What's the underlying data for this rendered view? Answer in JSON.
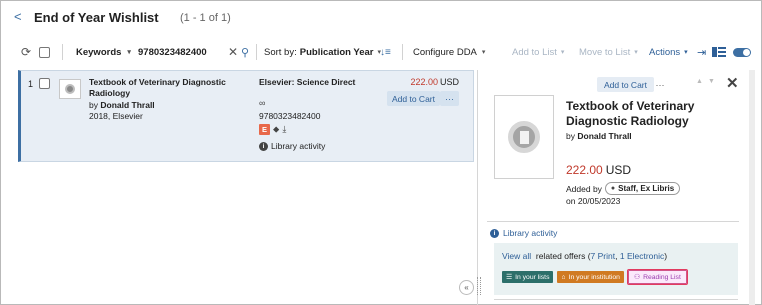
{
  "header": {
    "back_glyph": "<",
    "title": "End of Year Wishlist",
    "count": "(1 - 1 of 1)"
  },
  "toolbar": {
    "refresh_glyph": "⟳",
    "search_field": "Keywords",
    "search_value": "9780323482400",
    "clear_glyph": "✕",
    "search_glyph": "⚲",
    "sort_label": "Sort by:",
    "sort_value": "Publication Year",
    "sort_dir_glyph": "↓≡",
    "configure_dda": "Configure DDA",
    "add_to_list": "Add to List",
    "move_to_list": "Move to List",
    "actions": "Actions",
    "export_glyph": "⇥",
    "caret": "▾",
    "toggle_on": true
  },
  "result": {
    "row_number": "1",
    "title": "Textbook of Veterinary Diagnostic Radiology",
    "by": "by",
    "author": "Donald Thrall",
    "year_publisher": "2018, Elsevier",
    "vendor": "Elsevier: Science Direct",
    "infinity": "∞",
    "isbn": "9780323482400",
    "e_badge": "E",
    "tag_glyph": "⬥",
    "access_glyph": "⤓",
    "library_activity": "Library activity",
    "info_glyph": "i",
    "price_amount": "222.00",
    "price_currency": "USD",
    "add_to_cart": "Add to Cart",
    "more_glyph": "···"
  },
  "details": {
    "add_to_cart": "Add to Cart",
    "more_glyph": "···",
    "up_glyph": "▲",
    "down_glyph": "▼",
    "close_glyph": "✕",
    "title": "Textbook of Veterinary Diagnostic Radiology",
    "by": "by",
    "author": "Donald Thrall",
    "price_amount": "222.00",
    "price_currency": "USD",
    "added_by_label": "Added by",
    "added_by": "Staff, Ex Libris",
    "person_glyph": "●",
    "added_on": "on 20/05/2023",
    "library_activity": "Library activity",
    "info_glyph": "i",
    "view_all": "View all",
    "related_offers": "related offers (",
    "print_offers": "7 Print",
    "comma": ",",
    "electronic_offers": "1 Electronic",
    "close_paren": ")",
    "chip_lists_glyph": "☰",
    "chip_lists": "In your lists",
    "chip_inst_glyph": "⌂",
    "chip_inst": "In your institution",
    "chip_rl_glyph": "⚇",
    "chip_rl": "Reading List",
    "collapse_glyph": "«"
  },
  "colors": {
    "accent": "#3d6fa3",
    "price": "#c0392b",
    "selected_row": "#e8eef5",
    "chip_lists": "#2c6f6a",
    "chip_institution": "#d07a22",
    "chip_reading_list": "#9b3fb0"
  }
}
